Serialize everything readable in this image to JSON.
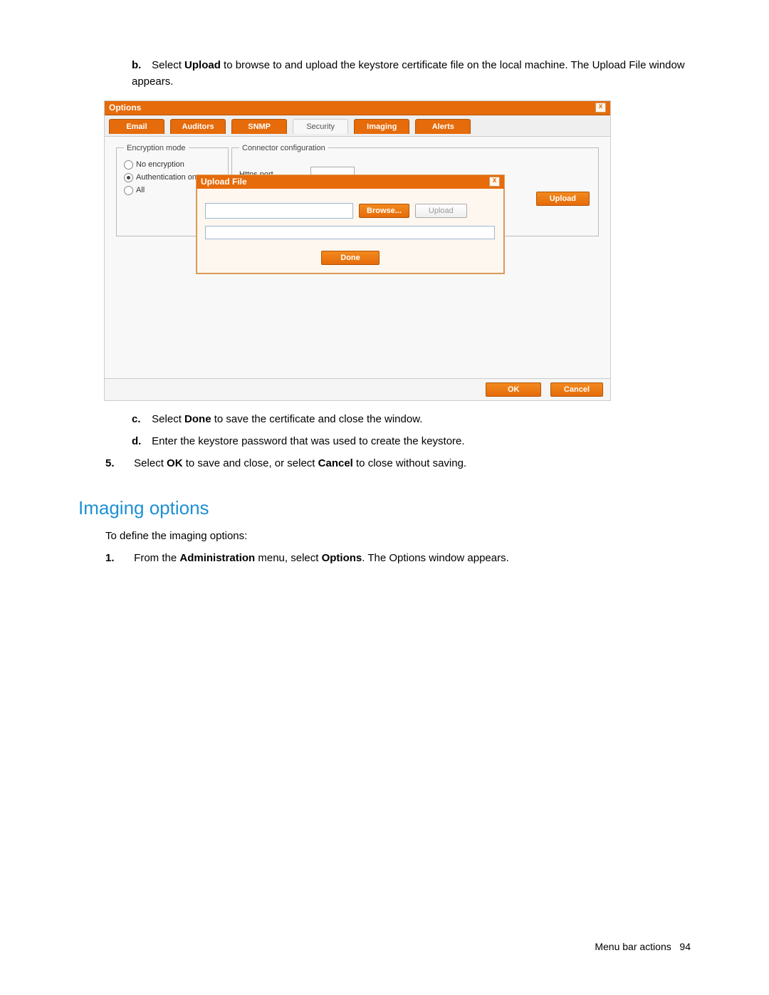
{
  "instructions": {
    "b_marker": "b.",
    "b_text_pre": "Select ",
    "b_bold": "Upload",
    "b_text_post": " to browse to and upload the keystore certificate file on the local machine. The Upload File window appears.",
    "c_marker": "c.",
    "c_pre": "Select ",
    "c_bold": "Done",
    "c_post": " to save the certificate and close the window.",
    "d_marker": "d.",
    "d_text": "Enter the keystore password that was used to create the keystore.",
    "five_marker": "5.",
    "five_pre": "Select ",
    "five_bold1": "OK",
    "five_mid": " to save and close, or select ",
    "five_bold2": "Cancel",
    "five_post": " to close without saving."
  },
  "section_heading": "Imaging options",
  "section_intro": "To define the imaging options:",
  "step1": {
    "marker": "1.",
    "pre": "From the ",
    "bold1": "Administration",
    "mid": " menu, select ",
    "bold2": "Options",
    "post": ". The Options window appears."
  },
  "window": {
    "title": "Options",
    "close": "x",
    "tabs": {
      "email": "Email",
      "auditors": "Auditors",
      "snmp": "SNMP",
      "security": "Security",
      "imaging": "Imaging",
      "alerts": "Alerts"
    },
    "encryption_legend": "Encryption mode",
    "enc_no": "No encryption",
    "enc_auth": "Authentication on",
    "enc_all": "All",
    "conn_legend": "Connector configuration",
    "https_port": "Https port",
    "upload_outer": "Upload",
    "ok": "OK",
    "cancel": "Cancel"
  },
  "modal": {
    "title": "Upload File",
    "close": "x",
    "browse": "Browse...",
    "upload": "Upload",
    "done": "Done"
  },
  "footer": {
    "text": "Menu bar actions",
    "page": "94"
  }
}
